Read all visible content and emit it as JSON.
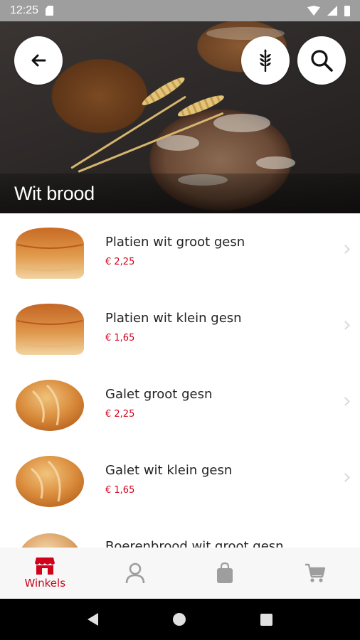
{
  "status_bar": {
    "time": "12:25"
  },
  "header": {
    "title": "Wit brood"
  },
  "products": [
    {
      "name": "Platien wit groot gesn",
      "price": "€ 2,25",
      "type": "loaf"
    },
    {
      "name": "Platien wit klein gesn",
      "price": "€ 1,65",
      "type": "loaf"
    },
    {
      "name": "Galet groot gesn",
      "price": "€ 2,25",
      "type": "round"
    },
    {
      "name": "Galet wit klein gesn",
      "price": "€ 1,65",
      "type": "round"
    },
    {
      "name": "Boerenbrood wit groot gesn",
      "price": "",
      "type": "round"
    }
  ],
  "bottom_nav": {
    "items": [
      {
        "icon": "store-icon",
        "label": "Winkels",
        "active": true
      },
      {
        "icon": "user-icon",
        "label": "",
        "active": false
      },
      {
        "icon": "bag-icon",
        "label": "",
        "active": false
      },
      {
        "icon": "cart-icon",
        "label": "",
        "active": false
      }
    ]
  },
  "colors": {
    "accent": "#d0021b",
    "inactive_icon": "#9e9e9e"
  }
}
